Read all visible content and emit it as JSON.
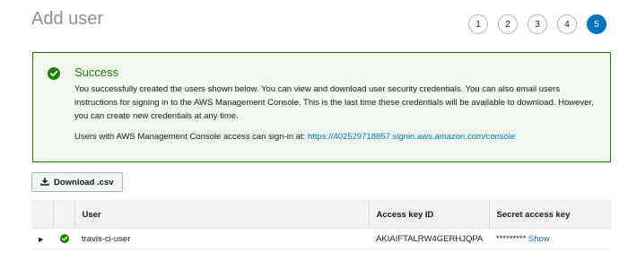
{
  "page": {
    "title": "Add user"
  },
  "wizard": {
    "steps": [
      "1",
      "2",
      "3",
      "4",
      "5"
    ],
    "active_index": 4
  },
  "alert": {
    "title": "Success",
    "body": "You successfully created the users shown below. You can view and download user security credentials. You can also email users instructions for signing in to the AWS Management Console. This is the last time these credentials will be available to download. However, you can create new credentials at any time.",
    "signin_prefix": "Users with AWS Management Console access can sign-in at:",
    "signin_url": "https://402529718857.signin.aws.amazon.com/console"
  },
  "toolbar": {
    "download_label": "Download .csv",
    "download_icon": "download-icon"
  },
  "table": {
    "headers": {
      "user": "User",
      "access_key_id": "Access key ID",
      "secret_access_key": "Secret access key"
    },
    "rows": [
      {
        "user": "travis-ci-user",
        "access_key_id": "AKIAIFTALRW4GERHJQPA",
        "secret_mask": "*********",
        "show_label": "Show",
        "status": "success"
      }
    ]
  },
  "colors": {
    "accent": "#0073bb",
    "success": "#1d8102",
    "success_bg": "#f2f8f0",
    "title_gray": "#879196"
  }
}
